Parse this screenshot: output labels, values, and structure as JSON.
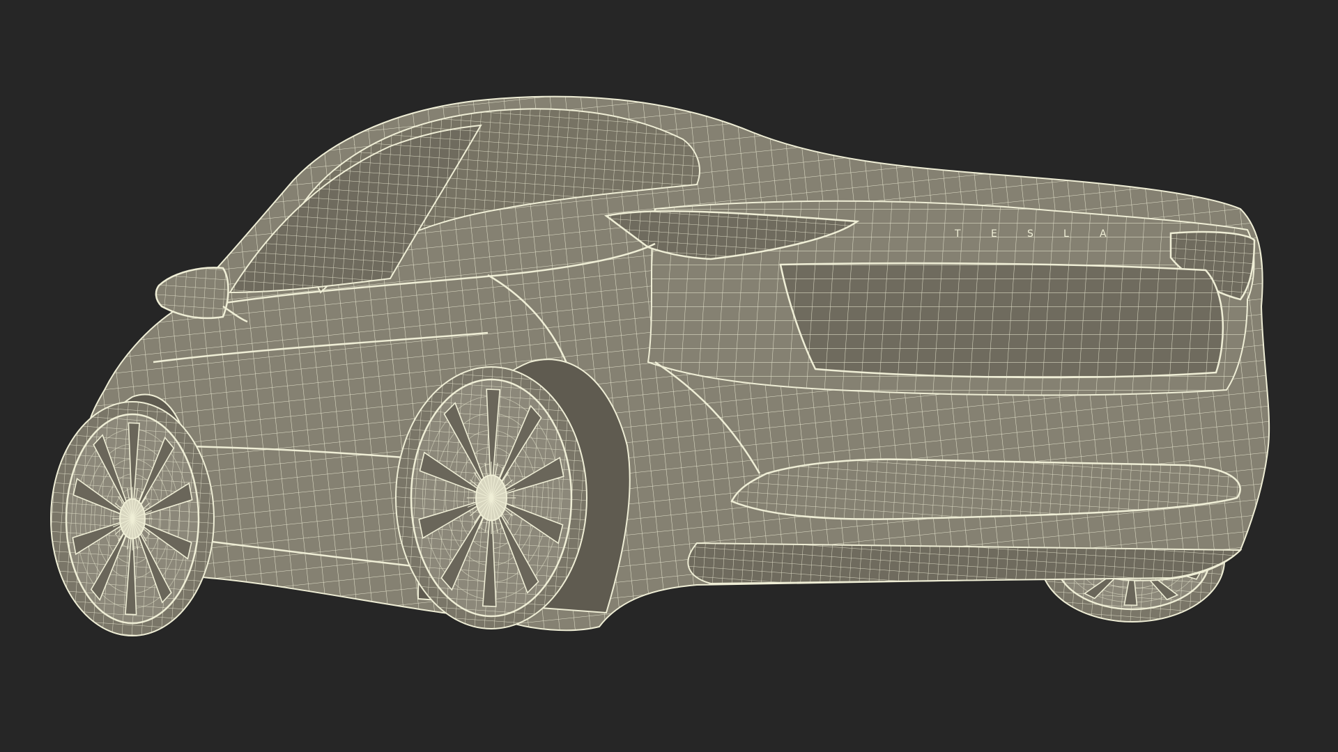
{
  "scene": {
    "subject": "car-wireframe-render",
    "colors": {
      "background": "#262626",
      "body_fill": "#858172",
      "body_fill_dark": "#6f6b5e",
      "glass_fill": "#777364",
      "wire": "#efeed6",
      "tire_fill": "#7a7668"
    },
    "badge_letters": "T E S L A",
    "wheel_spokes": 10
  }
}
